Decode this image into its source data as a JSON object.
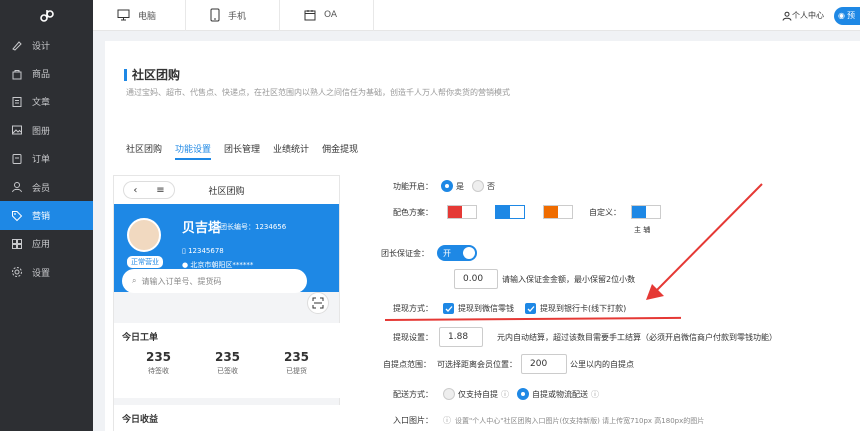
{
  "sidebar": {
    "logo": "ↁ",
    "items": [
      {
        "label": "设计",
        "icon": "brush-icon"
      },
      {
        "label": "商品",
        "icon": "bag-icon"
      },
      {
        "label": "文章",
        "icon": "doc-icon"
      },
      {
        "label": "图册",
        "icon": "image-icon"
      },
      {
        "label": "订单",
        "icon": "order-icon"
      },
      {
        "label": "会员",
        "icon": "user-icon"
      },
      {
        "label": "营销",
        "icon": "tag-icon",
        "active": true
      },
      {
        "label": "应用",
        "icon": "grid-icon"
      },
      {
        "label": "设置",
        "icon": "gear-icon"
      }
    ]
  },
  "topbar": {
    "tabs": [
      {
        "label": "电脑",
        "icon": "monitor-icon"
      },
      {
        "label": "手机",
        "icon": "phone-icon"
      },
      {
        "label": "OA",
        "icon": "calendar-icon"
      }
    ],
    "user_center": "个人中心",
    "preview_label": "预"
  },
  "page": {
    "title": "社区团购",
    "desc": "通过宝妈、超市、代售点、快递点，在社区范围内以熟人之间信任为基础，创造千人万人帮你卖货的营销模式",
    "tabs": [
      "社区团购",
      "功能设置",
      "团长管理",
      "业绩统计",
      "佣金提现"
    ],
    "active_tab": 1
  },
  "phone": {
    "title": "社区团购",
    "name": "贝吉塔",
    "id_label": "团长编号：1234656",
    "badge": "正常营业",
    "phone": "12345678",
    "address": "北京市朝阳区******",
    "search_placeholder": "请输入订单号、提货码",
    "today_orders_title": "今日工单",
    "stats": [
      {
        "num": "235",
        "label": "待签收"
      },
      {
        "num": "235",
        "label": "已签收"
      },
      {
        "num": "235",
        "label": "已提货"
      }
    ],
    "today_income_title": "今日收益"
  },
  "form": {
    "enable_label": "功能开启：",
    "enable_yes": "是",
    "enable_no": "否",
    "color_label": "配色方案：",
    "custom_label": "自定义：",
    "main_sub_label": "主  辅",
    "deposit_label": "团长保证金：",
    "deposit_toggle": "开",
    "deposit_amount": "0.00",
    "deposit_hint": "请输入保证金金额，最小保留2位小数",
    "withdraw_method_label": "提现方式：",
    "withdraw_wechat": "提现到微信零钱",
    "withdraw_bank": "提现到银行卡(线下打款)",
    "withdraw_setting_label": "提现设置：",
    "withdraw_value": "1.88",
    "withdraw_hint": "元内自动结算，超过该数目需要手工结算（必须开启微信商户付款到零钱功能）",
    "pickup_label": "自提点范围：",
    "pickup_prefix": "可选择距离会员位置：",
    "pickup_value": "200",
    "pickup_suffix": "公里以内的自提点",
    "delivery_label": "配送方式：",
    "delivery_self": "仅支持自提",
    "delivery_both": "自提或物流配送",
    "entry_label": "入口图片：",
    "entry_hint": "设置\"个人中心\"社区团购入口图片(仅支持新版) 请上传宽710px 高180px的图片"
  },
  "colors": {
    "accent": "#1e88e5",
    "sidebar": "#2d2f33",
    "red": "#e53935",
    "orange": "#ef6c00"
  }
}
